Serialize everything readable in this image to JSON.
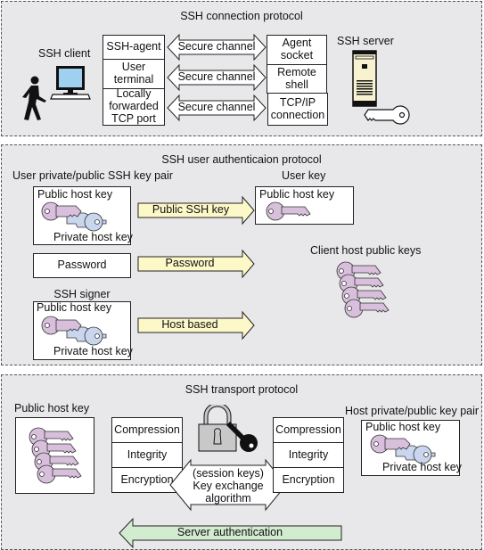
{
  "colors": {
    "panel_bg": "#e8e8ea",
    "key_public": "#d8bfdc",
    "key_private": "#c9d6ee",
    "arrow_yellow": "#fdf8c8",
    "arrow_green": "#d2ecd0",
    "monitor_screen": "#9fd0f0",
    "server_body": "#f8f2d0"
  },
  "connection_protocol": {
    "title": "SSH connection protocol",
    "client_label": "SSH client",
    "server_label": "SSH server",
    "client_cells": [
      "SSH-agent",
      "User\nterminal",
      "Locally\nforwarded\nTCP port"
    ],
    "server_cells": [
      "Agent\nsocket",
      "Remote\nshell",
      "TCP/IP\nconnection"
    ],
    "channels": [
      "Secure channel",
      "Secure channel",
      "Secure channel"
    ],
    "icons": [
      "person-walking-icon",
      "computer-monitor-icon",
      "server-tower-icon",
      "key-icon"
    ]
  },
  "user_auth_protocol": {
    "title": "SSH user authenticaion protocol",
    "keypair_heading": "User private/public SSH key pair",
    "keypair_public": "Public host key",
    "keypair_private": "Private host key",
    "password_box": "Password",
    "signer_heading": "SSH signer",
    "signer_public": "Public host key",
    "signer_private": "Private host key",
    "arrows": [
      "Public SSH key",
      "Password",
      "Host based"
    ],
    "user_key_heading": "User key",
    "user_key_box": "Public host key",
    "client_host_keys_heading": "Client host public keys"
  },
  "transport_protocol": {
    "title": "SSH transport protocol",
    "public_host_key_heading": "Public host key",
    "left_cells": [
      "Compression",
      "Integrity",
      "Encryption"
    ],
    "right_cells": [
      "Compression",
      "Integrity",
      "Encryption"
    ],
    "key_exchange": "(session keys)\nKey exchange\nalgorithm",
    "host_pair_heading": "Host private/public key pair",
    "host_pair_public": "Public host key",
    "host_pair_private": "Private host key",
    "server_auth": "Server authentication",
    "icons": [
      "padlock-icon",
      "key-icon"
    ]
  }
}
